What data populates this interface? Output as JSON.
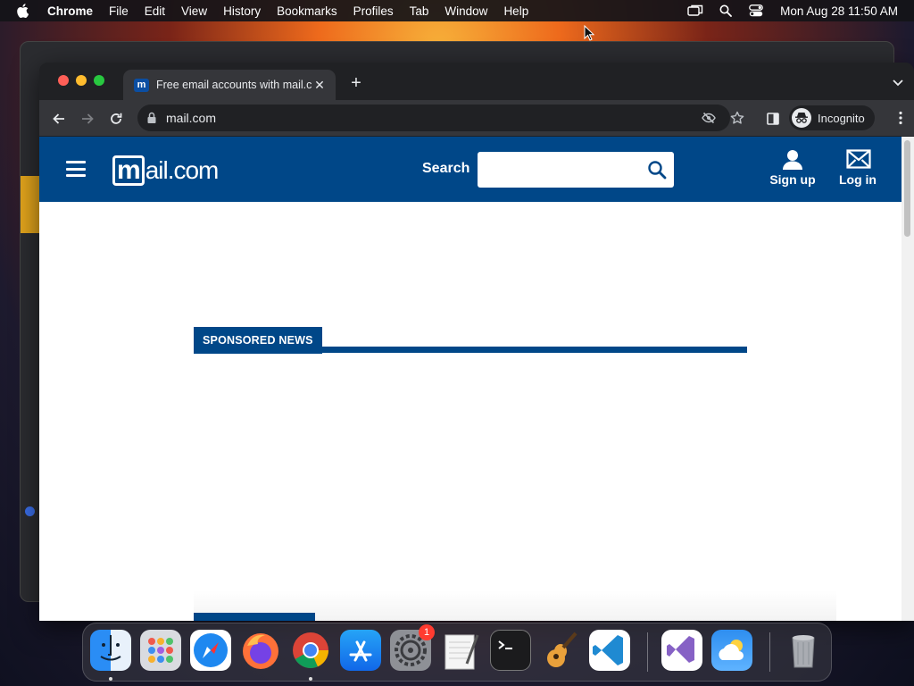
{
  "menubar": {
    "app_name": "Chrome",
    "items": [
      "File",
      "Edit",
      "View",
      "History",
      "Bookmarks",
      "Profiles",
      "Tab",
      "Window",
      "Help"
    ],
    "clock": "Mon Aug 28  11:50 AM",
    "icons": [
      "apple-icon",
      "screen-mirroring-icon",
      "spotlight-search-icon",
      "control-center-icon"
    ]
  },
  "browser": {
    "tab_title": "Free email accounts with mail.com",
    "favicon_letter": "m",
    "url": "mail.com",
    "profile_label": "Incognito"
  },
  "site": {
    "logo_mark": "m",
    "logo_text": "ail.com",
    "search_label": "Search",
    "search_placeholder": "",
    "signup_label": "Sign up",
    "login_label": "Log in",
    "sponsored_label": "SPONSORED NEWS",
    "brand_color": "#004788"
  },
  "dock": {
    "apps": [
      {
        "name": "Finder",
        "running": true
      },
      {
        "name": "Launchpad",
        "running": false
      },
      {
        "name": "Safari",
        "running": false
      },
      {
        "name": "Firefox",
        "running": false
      },
      {
        "name": "Google Chrome",
        "running": true
      },
      {
        "name": "App Store",
        "running": false
      },
      {
        "name": "System Settings",
        "running": false,
        "badge": "1"
      },
      {
        "name": "TextEdit",
        "running": false
      },
      {
        "name": "Terminal",
        "running": false
      },
      {
        "name": "GarageBand",
        "running": false
      },
      {
        "name": "Visual Studio Code",
        "running": false
      },
      {
        "name": "Visual Studio",
        "running": false
      },
      {
        "name": "Weather",
        "running": false
      },
      {
        "name": "Trash",
        "running": false
      }
    ]
  }
}
